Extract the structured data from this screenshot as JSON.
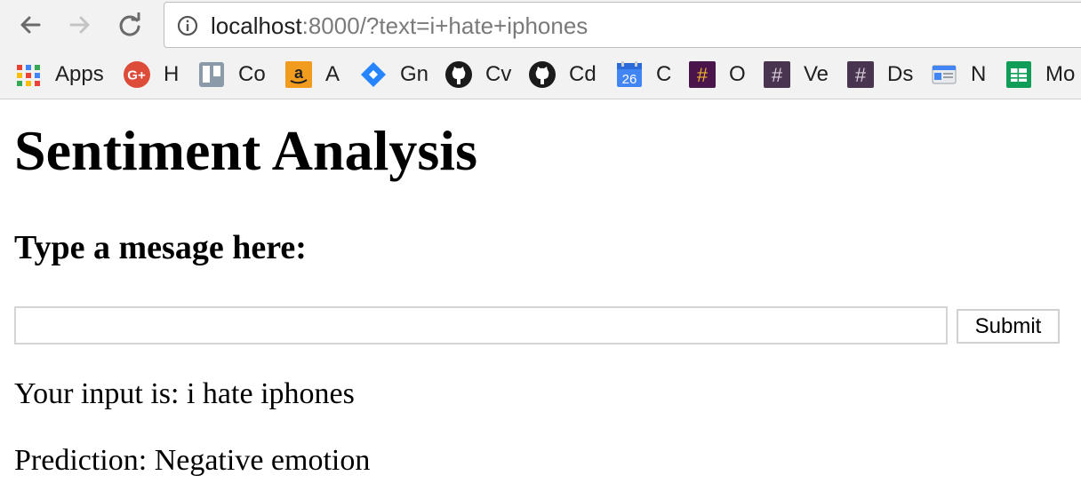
{
  "browser": {
    "url_host": "localhost",
    "url_rest": ":8000/?text=i+hate+iphones",
    "bookmarks": [
      {
        "label": "Apps",
        "icon": "apps-grid-icon"
      },
      {
        "label": "H",
        "icon": "google-plus-icon"
      },
      {
        "label": "Co",
        "icon": "trello-icon"
      },
      {
        "label": "A",
        "icon": "amazon-icon"
      },
      {
        "label": "Gn",
        "icon": "jira-icon"
      },
      {
        "label": "Cv",
        "icon": "github-icon"
      },
      {
        "label": "Cd",
        "icon": "github-icon"
      },
      {
        "label": "C",
        "icon": "calendar-icon",
        "badge": "26"
      },
      {
        "label": "O",
        "icon": "slack-hash-icon"
      },
      {
        "label": "Ve",
        "icon": "slack-hash-icon"
      },
      {
        "label": "Ds",
        "icon": "slack-hash-icon"
      },
      {
        "label": "N",
        "icon": "google-news-icon"
      },
      {
        "label": "Mo",
        "icon": "google-sheets-icon"
      }
    ]
  },
  "page": {
    "title": "Sentiment Analysis",
    "prompt": "Type a mesage here:",
    "input_value": "",
    "submit_label": "Submit",
    "input_echo": "Your input is: i hate iphones",
    "prediction": "Prediction: Negative emotion"
  },
  "colors": {
    "chrome_bg": "#f2f2f2",
    "amazon": "#f29c1f",
    "jira": "#2684ff",
    "slack": "#4a154b",
    "sheets": "#0f9d58",
    "calendar": "#4285f4",
    "gplus": "#dd4b39"
  }
}
